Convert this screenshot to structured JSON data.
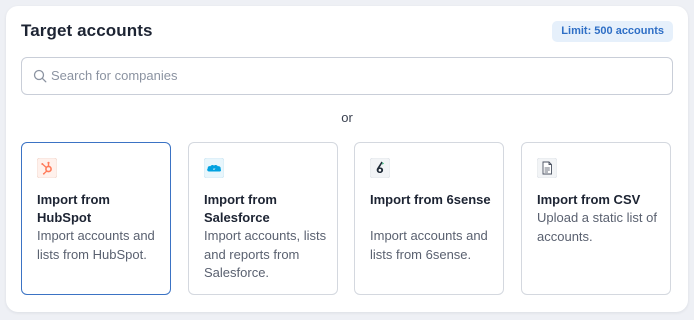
{
  "header": {
    "title": "Target accounts",
    "limit_badge": "Limit: 500 accounts"
  },
  "search": {
    "placeholder": "Search for companies",
    "value": ""
  },
  "separator": "or",
  "import_options": [
    {
      "id": "hubspot",
      "title": "Import from HubSpot",
      "description": "Import accounts and lists from HubSpot.",
      "icon": "hubspot-icon",
      "selected": true
    },
    {
      "id": "salesforce",
      "title": "Import from Salesforce",
      "description": "Import accounts, lists and reports from Salesforce.",
      "icon": "salesforce-icon",
      "selected": false
    },
    {
      "id": "6sense",
      "title": "Import from 6sense",
      "description": "Import accounts and lists from 6sense.",
      "icon": "6sense-icon",
      "selected": false
    },
    {
      "id": "csv",
      "title": "Import from CSV",
      "description": "Upload a static list of accounts.",
      "icon": "csv-file-icon",
      "selected": false
    }
  ],
  "colors": {
    "selected_border": "#3b73c4",
    "badge_bg": "#e6f0fb",
    "badge_text": "#2f6fc6",
    "hubspot": "#ff7a59",
    "salesforce": "#00a1e0",
    "sixsense": "#1f2a37"
  }
}
